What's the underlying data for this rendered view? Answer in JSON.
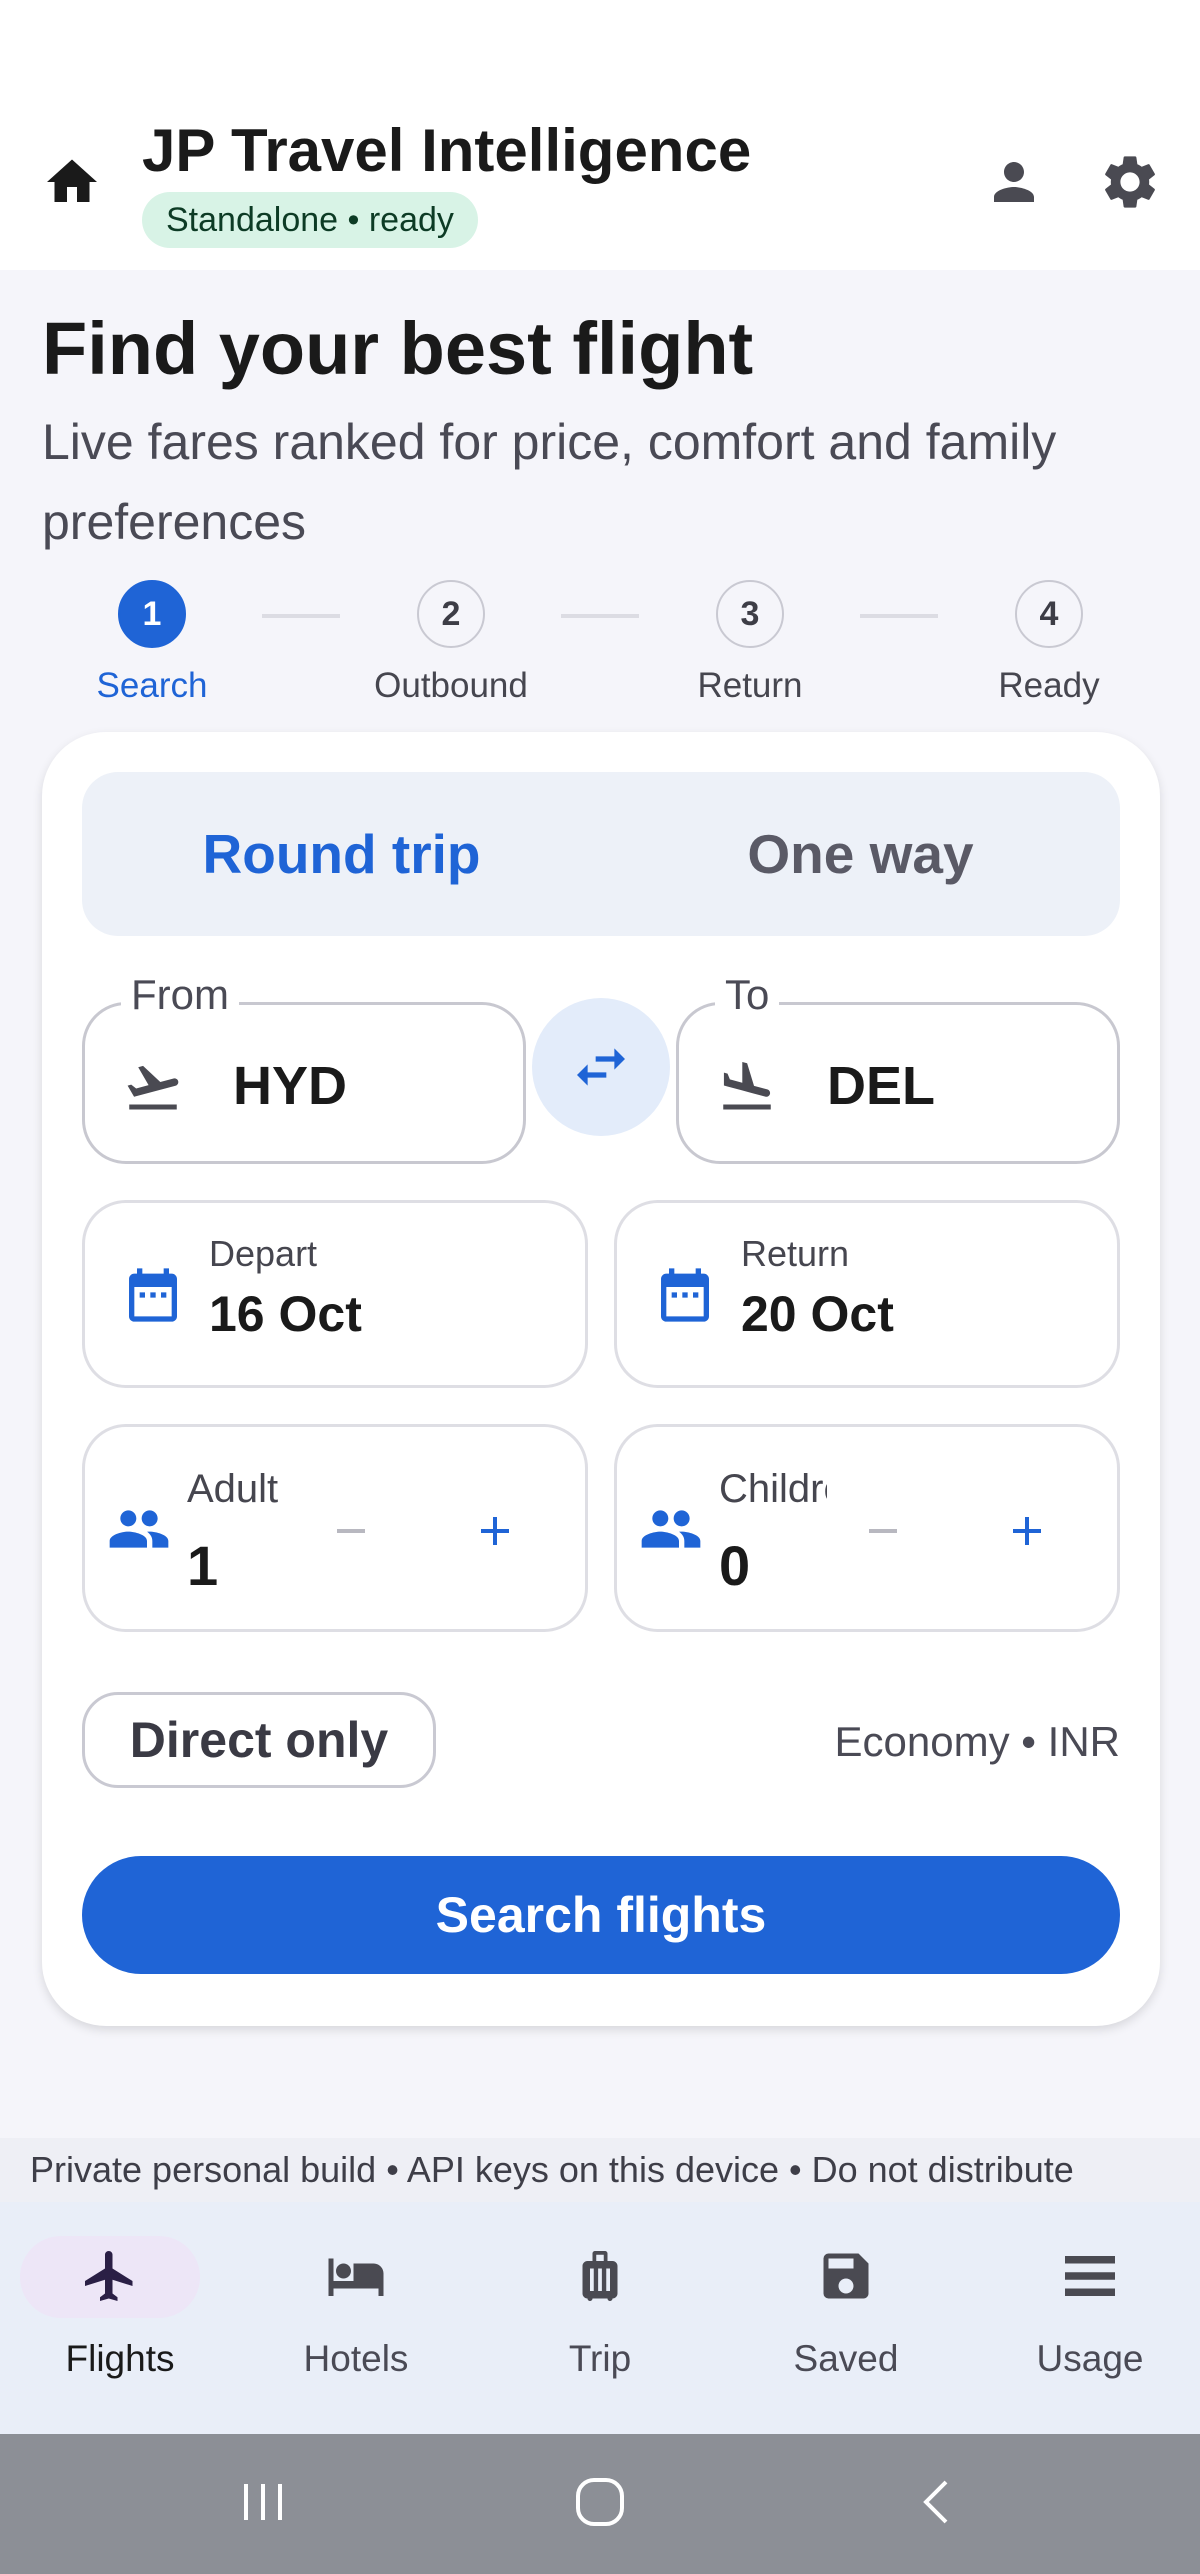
{
  "app": {
    "title": "JP Travel Intelligence",
    "status": "Standalone • ready",
    "icons": {
      "home": "home-icon",
      "profile": "person-icon",
      "settings": "gear-icon"
    }
  },
  "hero": {
    "title": "Find your best flight",
    "subtitle": "Live fares ranked for price, comfort and family preferences"
  },
  "stepper": {
    "current": 1,
    "steps": [
      {
        "number": "1",
        "label": "Search"
      },
      {
        "number": "2",
        "label": "Outbound"
      },
      {
        "number": "3",
        "label": "Return"
      },
      {
        "number": "4",
        "label": "Ready"
      }
    ]
  },
  "search": {
    "trip_types": {
      "selected": "Round trip",
      "round_trip": "Round trip",
      "one_way": "One way"
    },
    "from": {
      "label": "From",
      "value": "HYD"
    },
    "to": {
      "label": "To",
      "value": "DEL"
    },
    "depart": {
      "label": "Depart",
      "value": "16 Oct"
    },
    "return": {
      "label": "Return",
      "value": "20 Oct"
    },
    "adults": {
      "label": "Adult",
      "value": "1"
    },
    "children": {
      "label": "Children",
      "value": "0"
    },
    "direct_only_label": "Direct only",
    "class_currency": "Economy • INR",
    "submit_label": "Search flights"
  },
  "footer_note": "Private personal build • API keys on this device • Do not distribute",
  "nav": {
    "selected": "Flights",
    "items": [
      {
        "label": "Flights",
        "icon": "airplane-icon"
      },
      {
        "label": "Hotels",
        "icon": "bed-icon"
      },
      {
        "label": "Trip",
        "icon": "luggage-icon"
      },
      {
        "label": "Saved",
        "icon": "save-icon"
      },
      {
        "label": "Usage",
        "icon": "list-icon"
      }
    ]
  },
  "colors": {
    "accent": "#1f64d6",
    "status_bg": "#d8f3e6",
    "page_bg": "#f5f5fa",
    "nav_bg": "#e9eef8"
  }
}
